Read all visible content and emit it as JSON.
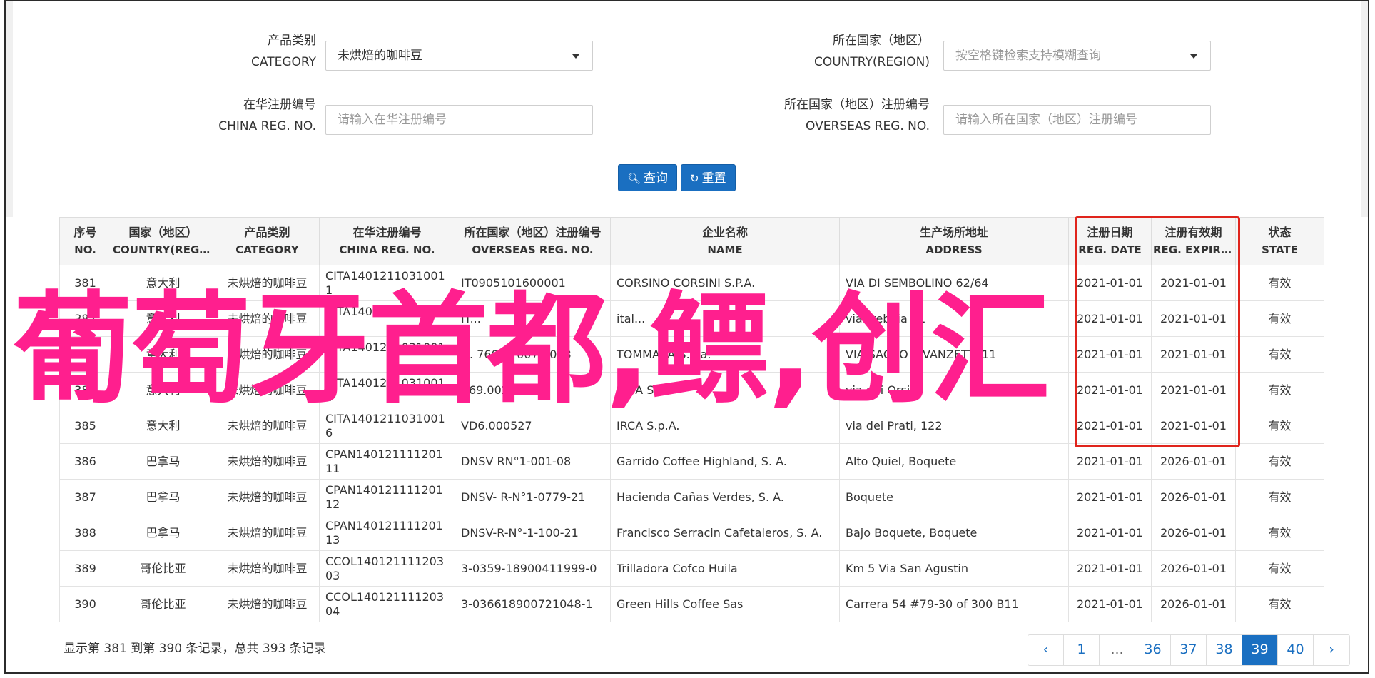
{
  "form": {
    "category_label_cn": "产品类别",
    "category_label_en": "CATEGORY",
    "category_value": "未烘焙的咖啡豆",
    "country_label_cn": "所在国家（地区）",
    "country_label_en": "COUNTRY(REGION)",
    "country_placeholder": "按空格键检索支持模糊查询",
    "china_reg_label_cn": "在华注册编号",
    "china_reg_label_en": "CHINA REG. NO.",
    "china_reg_placeholder": "请输入在华注册编号",
    "overseas_reg_label_cn": "所在国家（地区）注册编号",
    "overseas_reg_label_en": "OVERSEAS REG. NO.",
    "overseas_reg_placeholder": "请输入所在国家（地区）注册编号",
    "search_button": "查询",
    "reset_button": "重置"
  },
  "table": {
    "headers": [
      {
        "cn": "序号",
        "en": "NO."
      },
      {
        "cn": "国家（地区）",
        "en": "COUNTRY(REGIO..."
      },
      {
        "cn": "产品类别",
        "en": "CATEGORY"
      },
      {
        "cn": "在华注册编号",
        "en": "CHINA REG. NO."
      },
      {
        "cn": "所在国家（地区）注册编号",
        "en": "OVERSEAS REG. NO."
      },
      {
        "cn": "企业名称",
        "en": "NAME"
      },
      {
        "cn": "生产场所地址",
        "en": "ADDRESS"
      },
      {
        "cn": "注册日期",
        "en": "REG. DATE"
      },
      {
        "cn": "注册有效期",
        "en": "REG. EXPIRE ..."
      },
      {
        "cn": "状态",
        "en": "STATE"
      }
    ],
    "rows": [
      [
        "381",
        "意大利",
        "未烘焙的咖啡豆",
        "CITA14012110310011",
        "IT0905101600001",
        "CORSINO CORSINI S.P.A.",
        "VIA DI SEMBOLINO 62/64",
        "2021-01-01",
        "2021-01-01",
        "有效"
      ],
      [
        "382",
        "意大利",
        "未烘焙的咖啡豆",
        "CITA14012110310012",
        "IT...",
        "ital...",
        "via Trebbia 21",
        "2021-01-01",
        "2021-01-01",
        "有效"
      ],
      [
        "383",
        "意大利",
        "未烘焙的咖啡豆",
        "CITA14012110310013",
        "N. 760 ... 007/2003",
        "TOMMASA S.a.a.",
        "VIA SACCO E VANZETTI 11",
        "2021-01-01",
        "2021-01-01",
        "有效"
      ],
      [
        "384",
        "意大利",
        "未烘焙的咖啡豆",
        "CITA14012110310014",
        "V69.0026",
        "IRCA S.",
        "via dei Orsini",
        "2021-01-01",
        "2021-01-01",
        "有效"
      ],
      [
        "385",
        "意大利",
        "未烘焙的咖啡豆",
        "CITA14012110310016",
        "VD6.000527",
        "IRCA S.p.A.",
        "via dei Prati, 122",
        "2021-01-01",
        "2021-01-01",
        "有效"
      ],
      [
        "386",
        "巴拿马",
        "未烘焙的咖啡豆",
        "CPAN14012111120111",
        "DNSV RN°1-001-08",
        "Garrido Coffee Highland, S. A.",
        "Alto Quiel, Boquete",
        "2021-01-01",
        "2026-01-01",
        "有效"
      ],
      [
        "387",
        "巴拿马",
        "未烘焙的咖啡豆",
        "CPAN14012111120112",
        "DNSV- R-N°1-0779-21",
        "Hacienda Cañas Verdes, S. A.",
        "Boquete",
        "2021-01-01",
        "2026-01-01",
        "有效"
      ],
      [
        "388",
        "巴拿马",
        "未烘焙的咖啡豆",
        "CPAN14012111120113",
        "DNSV-R-N°-1-100-21",
        "Francisco Serracin Cafetaleros, S. A.",
        "Bajo Boquete, Boquete",
        "2021-01-01",
        "2026-01-01",
        "有效"
      ],
      [
        "389",
        "哥伦比亚",
        "未烘焙的咖啡豆",
        "CCOL14012111120303",
        "3-0359-18900411999-0",
        "Trilladora Cofco Huila",
        "Km 5 Via San Agustin",
        "2021-01-01",
        "2026-01-01",
        "有效"
      ],
      [
        "390",
        "哥伦比亚",
        "未烘焙的咖啡豆",
        "CCOL14012111120304",
        "3-036618900721048-1",
        "Green Hills Coffee Sas",
        "Carrera 54 #79-30 of 300 B11",
        "2021-01-01",
        "2026-01-01",
        "有效"
      ]
    ]
  },
  "overlay_text": "葡萄牙首都,鳔,创汇",
  "footer": {
    "info": "显示第 381 到第 390 条记录，总共 393 条记录"
  },
  "pager": {
    "prev": "‹",
    "pages": [
      "1",
      "...",
      "36",
      "37",
      "38",
      "39",
      "40"
    ],
    "active": "39",
    "next": "›"
  },
  "colors": {
    "primary": "#1a6fc1",
    "highlight_box": "#e0241c",
    "overlay": "#ff1f8e"
  }
}
